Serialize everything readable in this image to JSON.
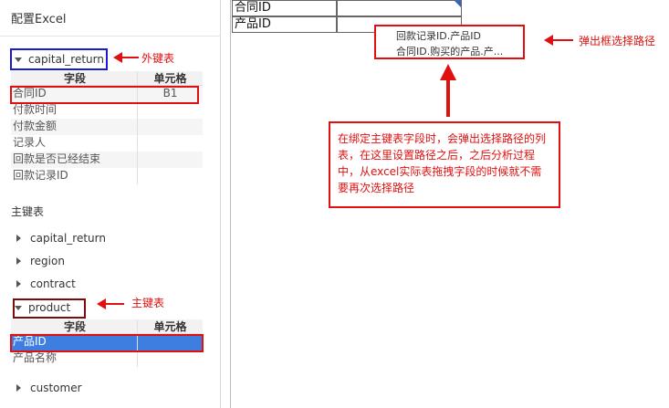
{
  "panel": {
    "title": "配置Excel"
  },
  "foreign_table": {
    "name": "capital_return",
    "header": {
      "field": "字段",
      "cell": "单元格"
    },
    "rows": [
      {
        "field": "合同ID",
        "cell": "B1"
      },
      {
        "field": "付款时间",
        "cell": ""
      },
      {
        "field": "付款金额",
        "cell": ""
      },
      {
        "field": "记录人",
        "cell": ""
      },
      {
        "field": "回款是否已经结束",
        "cell": ""
      },
      {
        "field": "回款记录ID",
        "cell": ""
      }
    ]
  },
  "primary_section": {
    "label": "主键表"
  },
  "primary_tables": [
    {
      "name": "capital_return"
    },
    {
      "name": "region"
    },
    {
      "name": "contract"
    }
  ],
  "product_table": {
    "name": "product",
    "header": {
      "field": "字段",
      "cell": "单元格"
    },
    "rows": [
      {
        "field": "产品ID",
        "cell": ""
      },
      {
        "field": "产品名称",
        "cell": ""
      }
    ]
  },
  "customer_table": {
    "name": "customer"
  },
  "sheet": {
    "rows": [
      {
        "a": "合同ID",
        "b": ""
      },
      {
        "a": "产品ID",
        "b": ""
      }
    ]
  },
  "popup": {
    "items": [
      "回款记录ID.产品ID",
      "合同ID.购买的产品.产..."
    ]
  },
  "annotations": {
    "foreign_key": "外键表",
    "primary_key": "主键表",
    "popup_path": "弹出框选择路径",
    "callout": "在绑定主键表字段时，会弹出选择路径的列表，在这里设置路径之后，之后分析过程中，从excel实际表拖拽字段的时候就不需要再次选择路径"
  },
  "colors": {
    "annotation": "#e01010",
    "selection": "#3d7ee0",
    "blue_box": "#1a1ad6"
  }
}
